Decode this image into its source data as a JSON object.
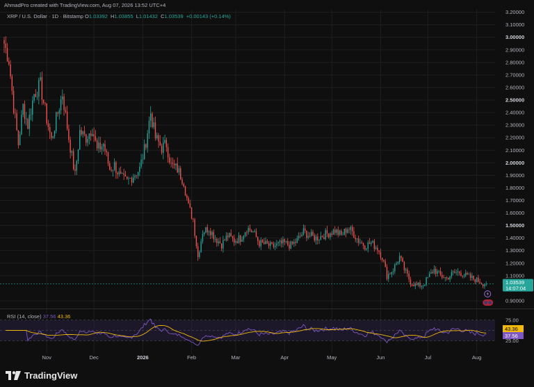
{
  "header": {
    "caption": "AhmadPro created with TradingView.com, Aug 07, 2026 13:52 UTC+4",
    "symbol": "XRP / U.S. Dollar · 1D · Bitstamp",
    "open_label": "O",
    "open": "1.03392",
    "high_label": "H",
    "high": "1.03855",
    "low_label": "L",
    "low": "1.01432",
    "close_label": "C",
    "close": "1.03539",
    "change": "+0.00143 (+0.14%)"
  },
  "rsi": {
    "label": "RSI (14, close)",
    "value": "37.56",
    "ma_value": "43.36",
    "levels": [
      75.0,
      50.0,
      25.0
    ],
    "level_labels": [
      "75.00",
      "25.00"
    ],
    "colors": {
      "rsi": "#7e57c2",
      "ma": "#f0b90b",
      "band": "#2a2040"
    }
  },
  "price_badge": {
    "price": "1.03539",
    "countdown": "14:07:04",
    "color": "#26a69a"
  },
  "colors": {
    "up": "#26a69a",
    "down": "#ef5350",
    "grid": "#1e1e1e",
    "bg": "#0f0f0f"
  },
  "footer": {
    "brand": "TradingView"
  },
  "chart_data": {
    "type": "candlestick",
    "ylim": [
      0.85,
      3.22
    ],
    "y_ticks": [
      "3.20000",
      "3.10000",
      "3.00000",
      "2.90000",
      "2.80000",
      "2.70000",
      "2.60000",
      "2.50000",
      "2.40000",
      "2.30000",
      "2.20000",
      "2.10000",
      "2.00000",
      "1.90000",
      "1.80000",
      "1.70000",
      "1.60000",
      "1.50000",
      "1.40000",
      "1.30000",
      "1.20000",
      "1.10000",
      "0.90000"
    ],
    "y_tick_values": [
      3.2,
      3.1,
      3.0,
      2.9,
      2.8,
      2.7,
      2.6,
      2.5,
      2.4,
      2.3,
      2.2,
      2.1,
      2.0,
      1.9,
      1.8,
      1.7,
      1.6,
      1.5,
      1.4,
      1.3,
      1.2,
      1.1,
      0.9
    ],
    "bold_ticks": [
      "3.00000",
      "2.50000",
      "2.00000",
      "1.50000"
    ],
    "x_ticks": [
      "Nov",
      "Dec",
      "2026",
      "Feb",
      "Mar",
      "Apr",
      "May",
      "Jun",
      "Jul",
      "Aug"
    ],
    "x_tick_day_index": [
      27,
      57,
      88,
      119,
      147,
      178,
      208,
      239,
      269,
      300
    ],
    "num_days": 310,
    "price_path": [
      [
        0,
        2.95
      ],
      [
        3,
        2.82
      ],
      [
        6,
        2.45
      ],
      [
        9,
        2.15
      ],
      [
        12,
        2.45
      ],
      [
        15,
        2.3
      ],
      [
        19,
        2.55
      ],
      [
        23,
        2.62
      ],
      [
        27,
        2.35
      ],
      [
        30,
        2.18
      ],
      [
        34,
        2.4
      ],
      [
        37,
        2.55
      ],
      [
        41,
        2.2
      ],
      [
        45,
        1.9
      ],
      [
        48,
        2.25
      ],
      [
        52,
        2.2
      ],
      [
        56,
        2.28
      ],
      [
        59,
        2.1
      ],
      [
        63,
        2.15
      ],
      [
        67,
        1.95
      ],
      [
        70,
        1.98
      ],
      [
        74,
        1.88
      ],
      [
        78,
        1.85
      ],
      [
        82,
        1.9
      ],
      [
        86,
        1.95
      ],
      [
        89,
        2.1
      ],
      [
        93,
        2.4
      ],
      [
        96,
        2.2
      ],
      [
        100,
        2.12
      ],
      [
        103,
        2.15
      ],
      [
        106,
        1.98
      ],
      [
        110,
        1.95
      ],
      [
        114,
        1.85
      ],
      [
        117,
        1.65
      ],
      [
        120,
        1.55
      ],
      [
        123,
        1.25
      ],
      [
        126,
        1.45
      ],
      [
        130,
        1.48
      ],
      [
        134,
        1.4
      ],
      [
        138,
        1.35
      ],
      [
        142,
        1.42
      ],
      [
        146,
        1.38
      ],
      [
        150,
        1.4
      ],
      [
        154,
        1.48
      ],
      [
        158,
        1.45
      ],
      [
        162,
        1.36
      ],
      [
        166,
        1.35
      ],
      [
        170,
        1.33
      ],
      [
        174,
        1.35
      ],
      [
        178,
        1.36
      ],
      [
        182,
        1.34
      ],
      [
        186,
        1.38
      ],
      [
        190,
        1.45
      ],
      [
        194,
        1.42
      ],
      [
        198,
        1.4
      ],
      [
        202,
        1.42
      ],
      [
        206,
        1.44
      ],
      [
        210,
        1.46
      ],
      [
        214,
        1.42
      ],
      [
        218,
        1.48
      ],
      [
        221,
        1.45
      ],
      [
        225,
        1.38
      ],
      [
        229,
        1.34
      ],
      [
        233,
        1.36
      ],
      [
        237,
        1.32
      ],
      [
        240,
        1.25
      ],
      [
        243,
        1.1
      ],
      [
        247,
        1.15
      ],
      [
        251,
        1.25
      ],
      [
        254,
        1.15
      ],
      [
        258,
        1.05
      ],
      [
        262,
        1.02
      ],
      [
        266,
        1.03
      ],
      [
        270,
        1.1
      ],
      [
        273,
        1.15
      ],
      [
        277,
        1.1
      ],
      [
        281,
        1.08
      ],
      [
        285,
        1.12
      ],
      [
        289,
        1.13
      ],
      [
        293,
        1.1
      ],
      [
        297,
        1.08
      ],
      [
        301,
        1.06
      ],
      [
        304,
        1.04
      ],
      [
        306,
        1.03539
      ]
    ]
  }
}
